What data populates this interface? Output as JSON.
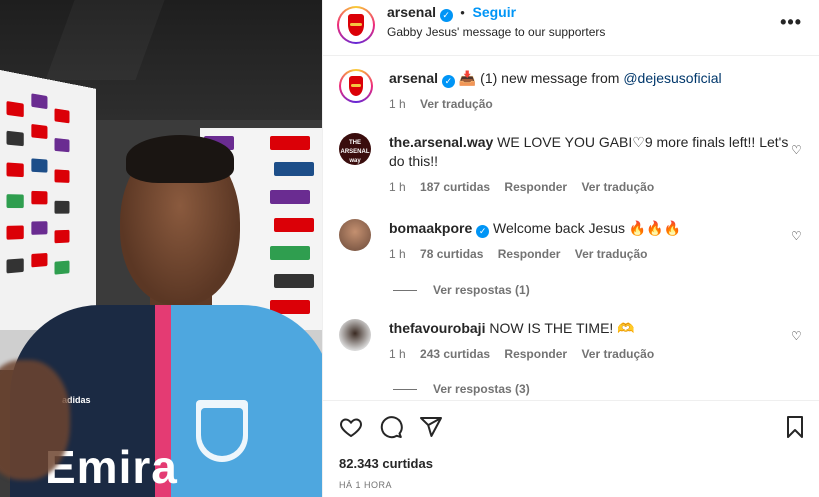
{
  "post": {
    "account": "arsenal",
    "follow_label": "Seguir",
    "caption_header": "Gabby Jesus' message to our supporters",
    "separator": "•",
    "more_options": "•••"
  },
  "caption": {
    "username": "arsenal",
    "text_prefix": "(1) new message from",
    "mention": "@dejesusoficial",
    "time": "1 h",
    "translate": "Ver tradução"
  },
  "comments": [
    {
      "username": "the.arsenal.way",
      "verified": false,
      "text": "WE LOVE YOU GABI♡9 more finals left!! Let's do this!!",
      "time": "1 h",
      "likes": "187 curtidas",
      "reply": "Responder",
      "translate": "Ver tradução",
      "avatar_label": "THE ARSENAL way"
    },
    {
      "username": "bomaakpore",
      "verified": true,
      "text": "Welcome back Jesus 🔥🔥🔥",
      "time": "1 h",
      "likes": "78 curtidas",
      "reply": "Responder",
      "translate": "Ver tradução",
      "view_replies": "Ver respostas (1)"
    },
    {
      "username": "thefavourobaji",
      "verified": false,
      "text": "NOW IS THE TIME! 🫶",
      "time": "1 h",
      "likes": "243 curtidas",
      "reply": "Responder",
      "translate": "Ver tradução",
      "view_replies": "Ver respostas (3)"
    }
  ],
  "footer": {
    "likes": "82.343 curtidas",
    "time_ago": "HÁ 1 HORA"
  },
  "media": {
    "shirt_text": "Emira",
    "brand": "adidas"
  },
  "icons": {
    "heart": "heart-icon",
    "comment": "comment-icon",
    "share": "share-icon",
    "save": "bookmark-icon",
    "more": "more-options-icon"
  },
  "colors": {
    "accent": "#0095f6",
    "arsenal_red": "#db0007",
    "muted": "#737373"
  }
}
